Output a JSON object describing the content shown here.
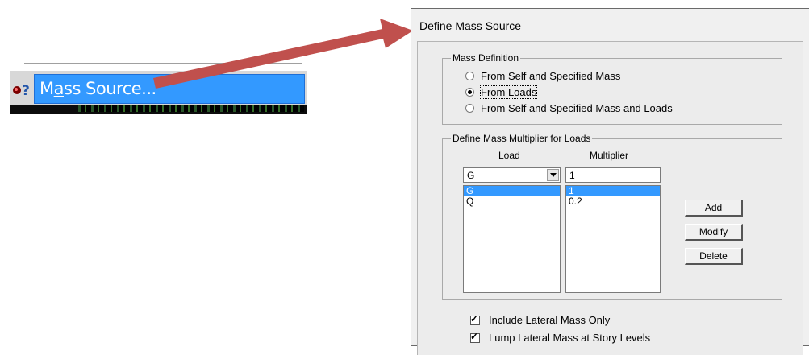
{
  "menu": {
    "item_label_pre": "M",
    "item_label_underlined": "a",
    "item_label_post": "ss Source...",
    "icon": "mass-source-icon"
  },
  "dialog": {
    "title": "Define Mass Source",
    "mass_definition": {
      "group_label": "Mass Definition",
      "options": [
        {
          "label": "From Self and Specified Mass",
          "selected": false
        },
        {
          "label": "From Loads",
          "selected": true
        },
        {
          "label": "From Self and Specified Mass and Loads",
          "selected": false
        }
      ]
    },
    "multiplier_group": {
      "group_label": "Define Mass Multiplier for Loads",
      "load_header": "Load",
      "multiplier_header": "Multiplier",
      "load_combo_value": "G",
      "multiplier_input_value": "1",
      "loads": [
        "G",
        "Q"
      ],
      "multipliers": [
        "1",
        "0.2"
      ],
      "selected_index": 0,
      "add_label": "Add",
      "modify_label": "Modify",
      "delete_label": "Delete"
    },
    "checks": [
      {
        "label": "Include Lateral Mass Only",
        "checked": true
      },
      {
        "label": "Lump Lateral Mass at Story Levels",
        "checked": true
      }
    ]
  },
  "colors": {
    "highlight": "#3399ff",
    "arrow": "#c0504d"
  }
}
